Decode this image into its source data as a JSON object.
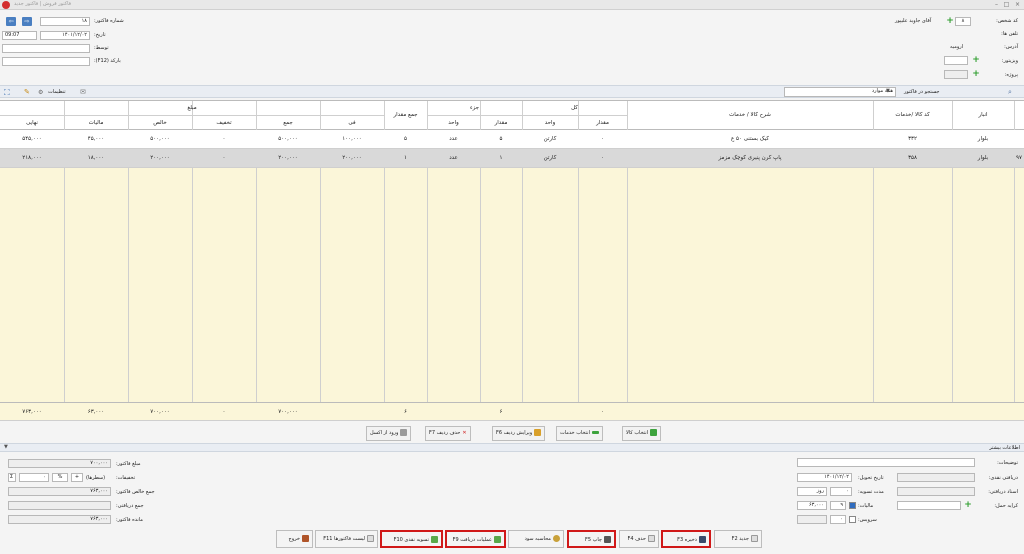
{
  "window": {
    "title": "فاکتور فروش | فاکتور جدید"
  },
  "header_right": {
    "customer_code_label": "کد شخص:",
    "customer_code": "۸",
    "customer_name": "آقای جاوید علیپور",
    "phone_label": "تلفن ها:",
    "address_label": "آدرس:",
    "address": "ارومیه",
    "visitor_label": "ویزیتور:",
    "project_label": "پروژه:"
  },
  "header_left": {
    "invoice_no_label": "شماره فاکتور:",
    "invoice_no": "۱۸",
    "date_label": "تاریخ:",
    "date": "۱۴۰۱/۱۲/۰۲",
    "time": "09:07",
    "by_label": "توسط:",
    "barcode_label": "بارکد (F12):"
  },
  "toolbar": {
    "search_label": "جستجو در فاکتور",
    "search_value": "همه موارد",
    "settings_label": "تنظیمات"
  },
  "grid": {
    "group_headers": {
      "total": "کل",
      "part": "جزء",
      "amount": "مبلغ"
    },
    "columns": {
      "warehouse": "انبار",
      "code": "کد کالا /خدمات",
      "desc": "شرح کالا / خدمات",
      "qty_total": "مقدار",
      "unit_total": "واحد",
      "qty_part": "مقدار",
      "unit_part": "واحد",
      "total_qty": "جمع مقدار",
      "fee": "فی",
      "sum": "جمع",
      "discount": "تخفیف",
      "net": "خالص",
      "tax": "مالیات",
      "final": "نهایی"
    },
    "rows": [
      {
        "idx": "",
        "warehouse": "بلوار",
        "code": "۳۳۲",
        "desc": "کیک بستنی ۵۰ ع",
        "qty_total": "۰",
        "unit_total": "کارتن",
        "qty_part": "۵",
        "unit_part": "عدد",
        "total_qty": "۵",
        "fee": "۱۰۰,۰۰۰",
        "sum": "۵۰۰,۰۰۰",
        "discount": "۰",
        "net": "۵۰۰,۰۰۰",
        "tax": "۴۵,۰۰۰",
        "final": "۵۴۵,۰۰۰"
      },
      {
        "idx": "۹۷",
        "warehouse": "بلوار",
        "code": "۳۵۸",
        "desc": "پاپ کرن پنیری کوچک مزمز",
        "qty_total": "۰",
        "unit_total": "کارتن",
        "qty_part": "۱",
        "unit_part": "عدد",
        "total_qty": "۱",
        "fee": "۲۰۰,۰۰۰",
        "sum": "۲۰۰,۰۰۰",
        "discount": "۰",
        "net": "۲۰۰,۰۰۰",
        "tax": "۱۸,۰۰۰",
        "final": "۲۱۸,۰۰۰"
      }
    ],
    "totals": {
      "qty_total": "۰",
      "qty_part": "۶",
      "total_qty": "۶",
      "sum": "۷۰۰,۰۰۰",
      "discount": "۰",
      "net": "۷۰۰,۰۰۰",
      "tax": "۶۳,۰۰۰",
      "final": "۷۶۳,۰۰۰"
    }
  },
  "grid_buttons": {
    "select_goods": "انتخاب کالا",
    "select_services": "انتخاب خدمات",
    "edit_row": "ویرایش ردیف F6",
    "delete_row": "حذف ردیف F7",
    "import_excel": "ورود از اکسل"
  },
  "more_info": {
    "label": "اطلاعات بیشتر"
  },
  "bottom_right": {
    "description_label": "توضیحات:",
    "cash_received_label": "دریافتی نقدی:",
    "delivery_date_label": "تاریخ تحویل:",
    "delivery_date": "۱۴۰۱/۱۲/۰۲",
    "doc_received_label": "اسناد دریافتی:",
    "settle_period_label": "مدت تسویه:",
    "settle_unit": "روز",
    "settle_value": "۰",
    "freight_label": "کرایه حمل:",
    "tax_label": "مالیات:",
    "tax_percent": "۹",
    "tax_amount": "۶۳,۰۰۰",
    "service_label": "سرویس:",
    "service_percent": "۰"
  },
  "bottom_left": {
    "invoice_amount_label": "مبلغ فاکتور:",
    "invoice_amount": "۷۰۰,۰۰۰",
    "discounts_label": "تخفیفات:",
    "discounts_row": "(سطرها)",
    "discount_value": "۰",
    "net_total_label": "جمع خالص فاکتور:",
    "net_total": "۷۶۳,۰۰۰",
    "received_total_label": "جمع دریافتی:",
    "remaining_label": "مانده فاکتور:",
    "remaining": "۷۶۳,۰۰۰"
  },
  "footer": {
    "new": "جدید F2",
    "save": "ذخیره F3",
    "delete": "حذف F4",
    "print": "چاپ F5",
    "profit": "محاسبه سود",
    "receive_ops": "عملیات دریافت F9",
    "cash_settle": "تسویه نقدی F10",
    "invoice_list": "لیست فاکتورها F11",
    "exit": "خروج"
  }
}
